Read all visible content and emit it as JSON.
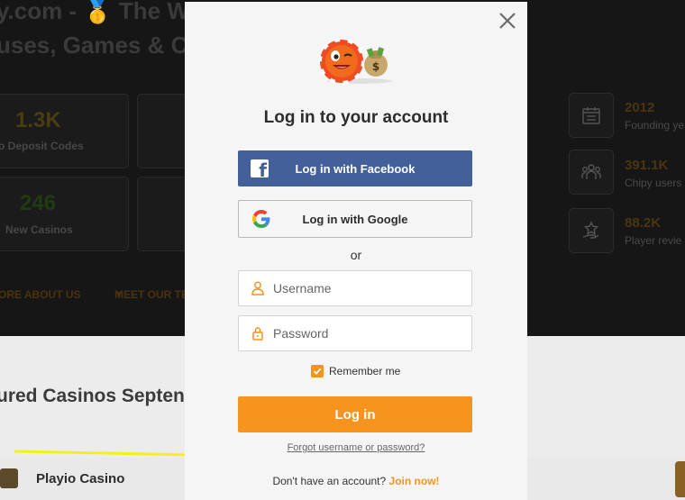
{
  "background": {
    "title_line1": "y.com - 🥇 The W",
    "title_line2": "uses, Games & C",
    "stats": [
      {
        "value": "1.3K",
        "label": "o Deposit Codes"
      },
      {
        "value": "246",
        "label": "New Casinos"
      }
    ],
    "links": [
      "ORE ABOUT US",
      "MEET OUR TE"
    ],
    "right_stats": [
      {
        "value": "2012",
        "label": "Founding ye",
        "icon": "calendar-icon"
      },
      {
        "value": "391.1K",
        "label": "Chipy users",
        "icon": "users-icon"
      },
      {
        "value": "88.2K",
        "label": "Player revie",
        "icon": "star-hand-icon"
      }
    ],
    "section_title": "ured Casinos Septen",
    "casino_row_name": "Playio Casino"
  },
  "modal": {
    "title": "Log in to your account",
    "facebook_label": "Log in with Facebook",
    "google_label": "Log in with Google",
    "or_text": "or",
    "username_placeholder": "Username",
    "password_placeholder": "Password",
    "remember_label": "Remember me",
    "remember_checked": true,
    "login_label": "Log in",
    "forgot_label": "Forgot username or password?",
    "signup_prompt": "Don't have an account?",
    "signup_link": "Join now!"
  },
  "colors": {
    "accent": "#f7941d",
    "facebook": "#44609b",
    "annotation_arrow": "#f5f01a"
  }
}
